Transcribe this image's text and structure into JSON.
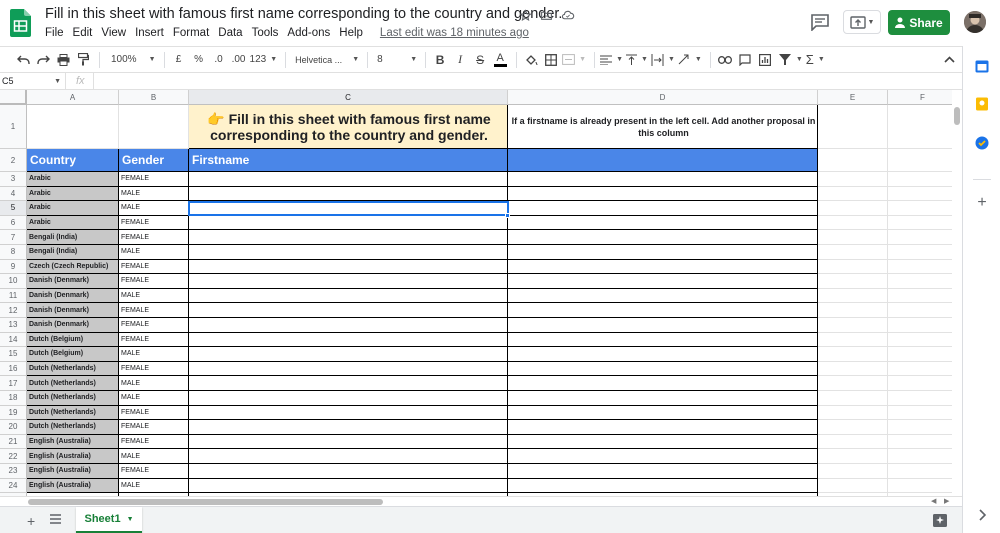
{
  "header": {
    "doc_title": "Fill in this sheet with famous first name corresponding to the country and gender.",
    "menu": [
      "File",
      "Edit",
      "View",
      "Insert",
      "Format",
      "Data",
      "Tools",
      "Add-ons",
      "Help"
    ],
    "last_edit": "Last edit was 18 minutes ago",
    "share_label": "Share"
  },
  "toolbar": {
    "zoom": "100%",
    "currency": "£",
    "percent": "%",
    "dec_decrease": ".0",
    "dec_increase": ".00",
    "more_formats": "123",
    "font": "Helvetica ...",
    "font_size": "8",
    "bold": "B",
    "italic": "I",
    "strike": "S",
    "text_color": "A"
  },
  "formula_bar": {
    "name_box": "C5",
    "fx": "fx",
    "value": ""
  },
  "columns": [
    "A",
    "B",
    "C",
    "D",
    "E",
    "F"
  ],
  "row_numbers": [
    "1",
    "2",
    "3",
    "4",
    "5",
    "6",
    "7",
    "8",
    "9",
    "10",
    "11",
    "12",
    "13",
    "14",
    "15",
    "16",
    "17",
    "18",
    "19",
    "20",
    "21",
    "22",
    "23",
    "24",
    "25"
  ],
  "sheet": {
    "banner": "👉 Fill in this sheet with famous first name corresponding to the country and gender.",
    "note": "If a firstname is already present in the left cell. Add another proposal in this column",
    "headers": {
      "country": "Country",
      "gender": "Gender",
      "firstname": "Firstname"
    },
    "rows": [
      {
        "country": "Arabic",
        "gender": "FEMALE"
      },
      {
        "country": "Arabic",
        "gender": "MALE"
      },
      {
        "country": "Arabic",
        "gender": "MALE"
      },
      {
        "country": "Arabic",
        "gender": "FEMALE"
      },
      {
        "country": "Bengali (India)",
        "gender": "FEMALE"
      },
      {
        "country": "Bengali (India)",
        "gender": "MALE"
      },
      {
        "country": "Czech (Czech Republic)",
        "gender": "FEMALE"
      },
      {
        "country": "Danish (Denmark)",
        "gender": "FEMALE"
      },
      {
        "country": "Danish (Denmark)",
        "gender": "MALE"
      },
      {
        "country": "Danish (Denmark)",
        "gender": "FEMALE"
      },
      {
        "country": "Danish (Denmark)",
        "gender": "FEMALE"
      },
      {
        "country": "Dutch (Belgium)",
        "gender": "FEMALE"
      },
      {
        "country": "Dutch (Belgium)",
        "gender": "MALE"
      },
      {
        "country": "Dutch (Netherlands)",
        "gender": "FEMALE"
      },
      {
        "country": "Dutch (Netherlands)",
        "gender": "MALE"
      },
      {
        "country": "Dutch (Netherlands)",
        "gender": "MALE"
      },
      {
        "country": "Dutch (Netherlands)",
        "gender": "FEMALE"
      },
      {
        "country": "Dutch (Netherlands)",
        "gender": "FEMALE"
      },
      {
        "country": "English (Australia)",
        "gender": "FEMALE"
      },
      {
        "country": "English (Australia)",
        "gender": "MALE"
      },
      {
        "country": "English (Australia)",
        "gender": "FEMALE"
      },
      {
        "country": "English (Australia)",
        "gender": "MALE"
      },
      {
        "country": "",
        "gender": ""
      }
    ]
  },
  "tabs": {
    "sheet1": "Sheet1"
  },
  "colors": {
    "accent_green": "#1e8e3e",
    "header_blue": "#4a86e8",
    "banner_yellow": "#fff2cc",
    "country_gray": "#c8c8c8",
    "selection": "#1a73e8"
  }
}
